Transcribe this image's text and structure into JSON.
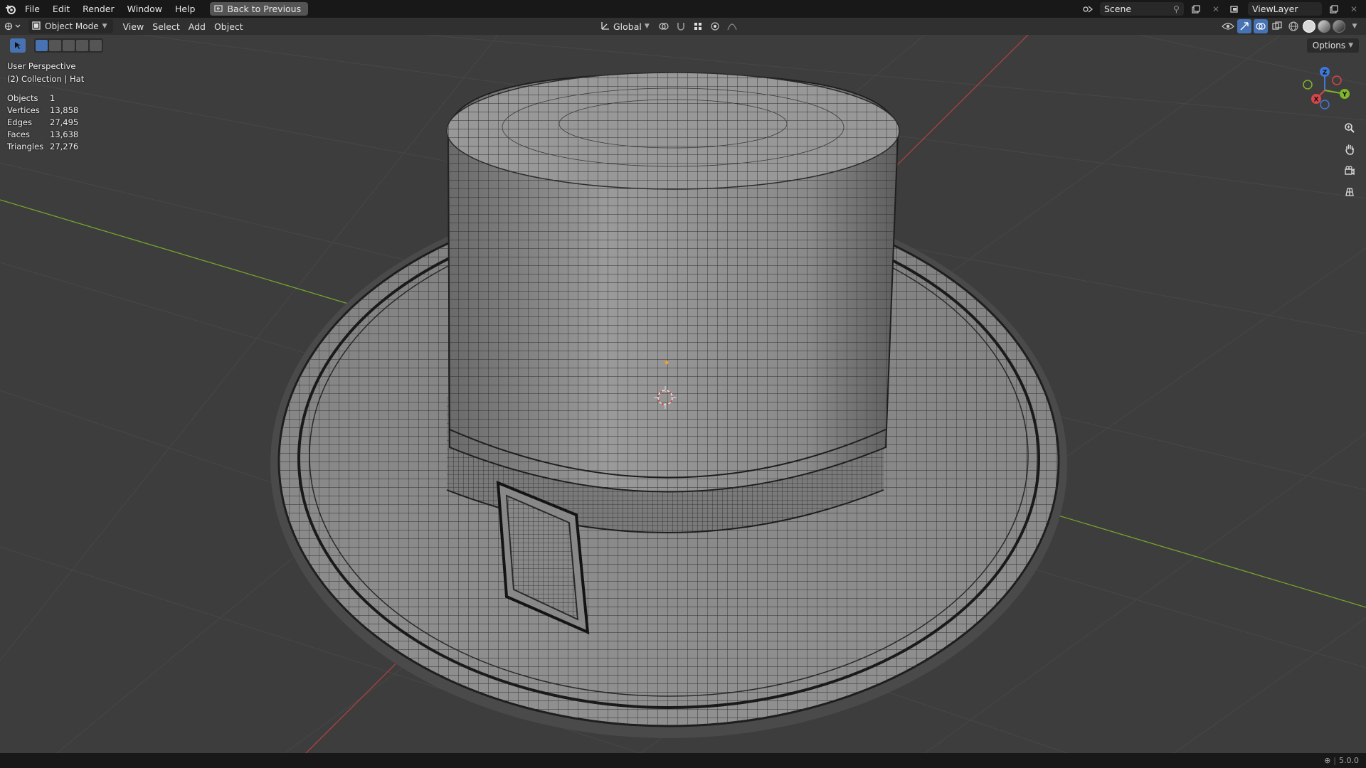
{
  "menu": {
    "items": [
      "File",
      "Edit",
      "Render",
      "Window",
      "Help"
    ],
    "back_button": "Back to Previous"
  },
  "workspace": {
    "scene_name": "Scene",
    "view_layer": "ViewLayer"
  },
  "header": {
    "mode": "Object Mode",
    "menus": [
      "View",
      "Select",
      "Add",
      "Object"
    ],
    "transform_orientation": "Global",
    "options_label": "Options"
  },
  "viewport": {
    "perspective_label": "User Perspective",
    "collection_label": "(2) Collection | Hat",
    "stats": [
      {
        "label": "Objects",
        "value": "1"
      },
      {
        "label": "Vertices",
        "value": "13,858"
      },
      {
        "label": "Edges",
        "value": "27,495"
      },
      {
        "label": "Faces",
        "value": "13,638"
      },
      {
        "label": "Triangles",
        "value": "27,276"
      }
    ],
    "gizmo_axes": {
      "x": "X",
      "y": "Y",
      "z": "Z"
    }
  },
  "status": {
    "version": "5.0.0"
  },
  "colors": {
    "axis_x": "#d7464b",
    "axis_y": "#7fb62a",
    "axis_z": "#3f79d8",
    "accent": "#4772b3"
  },
  "icons": {
    "zoom": "zoom-icon",
    "pan": "hand-icon",
    "camera": "camera-icon",
    "grid": "grid-icon"
  }
}
